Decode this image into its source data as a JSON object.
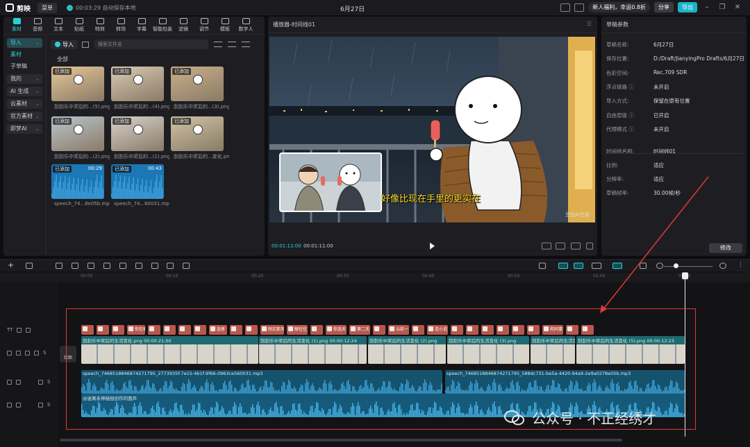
{
  "app": {
    "name": "剪映",
    "menu": "菜单",
    "autosave": "00:03:29 自动保存本地",
    "project_title": "6月27日"
  },
  "topbar": {
    "promo": "新人福利，幸运0.8折",
    "share": "分享",
    "export": "导出"
  },
  "tools": [
    "素材",
    "音频",
    "文本",
    "贴纸",
    "特效",
    "转场",
    "字幕",
    "智能包装",
    "滤镜",
    "调节",
    "模板",
    "数字人"
  ],
  "sidebar": {
    "items": [
      {
        "label": "导入",
        "active": true
      },
      {
        "label": "素材",
        "sub": true
      },
      {
        "label": "子草稿",
        "plain": true
      },
      {
        "label": "我的"
      },
      {
        "label": "AI 生成"
      },
      {
        "label": "云素材"
      },
      {
        "label": "官方素材"
      },
      {
        "label": "即梦AI"
      }
    ]
  },
  "media": {
    "import_label": "导入",
    "search_placeholder": "搜索文件名",
    "all_label": "全部",
    "items": [
      {
        "badge": "已添加",
        "name": "刮刮乐中奖后的...(5).png",
        "dur": ""
      },
      {
        "badge": "已添加",
        "name": "刮刮乐中奖后的...(4).png",
        "dur": ""
      },
      {
        "badge": "已添加",
        "name": "刮刮乐中奖后的...(3).png",
        "dur": ""
      },
      {
        "badge": "已添加",
        "name": "刮刮乐中奖后的...(2).png",
        "dur": ""
      },
      {
        "badge": "已添加",
        "name": "刮刮乐中奖后的...(1).png",
        "dur": ""
      },
      {
        "badge": "已添加",
        "name": "刮刮乐中奖后的...变化.png",
        "dur": ""
      },
      {
        "badge": "已添加",
        "name": "speech_74...8e05b.mp3",
        "dur": "00:29"
      },
      {
        "badge": "已添加",
        "name": "speech_74...60031.mp3",
        "dur": "00:43"
      }
    ]
  },
  "player": {
    "title": "播放器-时间线01",
    "subtitle": "好像比现在手里的更实在",
    "watermark": "豆包AI生成",
    "time_current": "00:01:11:00",
    "time_total": "00:01:11:00"
  },
  "props": {
    "title": "草稿参数",
    "rows": [
      {
        "label": "草稿名称:",
        "value": "6月27日"
      },
      {
        "label": "保存位置:",
        "value": "D:/Draft/JianyingPro Drafts/6月27日"
      },
      {
        "label": "色彩空间:",
        "value": "Rec.709 SDR"
      },
      {
        "label": "浮点链路 ⓘ",
        "value": "未开启"
      },
      {
        "label": "导入方式:",
        "value": "保留在原有位置"
      },
      {
        "label": "自由层级 ⓘ",
        "value": "已开启"
      },
      {
        "label": "代理模式 ⓘ",
        "value": "未开启"
      }
    ],
    "rows2": [
      {
        "label": "时间线名称:",
        "value": "时间线01"
      },
      {
        "label": "比例:",
        "value": "适应"
      },
      {
        "label": "分辨率:",
        "value": "适应"
      },
      {
        "label": "草稿帧率:",
        "value": "30.00帧/秒"
      }
    ],
    "modify": "修改"
  },
  "timeline": {
    "ticks": [
      "00:00",
      "00:10",
      "00:20",
      "00:30",
      "00:40",
      "00:50",
      "01:00",
      "01:10"
    ],
    "cover": "封面",
    "subtitle_clips": [
      "",
      "",
      "",
      "你在嘴",
      "",
      "",
      "",
      "",
      "选者",
      "",
      "",
      "刚买那天",
      "眼往往",
      "",
      "你选天",
      "第二天",
      "",
      "以前一",
      "",
      "连小说",
      "",
      "",
      "",
      "",
      "",
      "",
      "和同事",
      "",
      ""
    ],
    "video_clips": [
      {
        "label": "刮刮乐中奖后的生活变化.png  00:00:21:00"
      },
      {
        "label": "刮刮乐中奖后的生活变化 (1).png  00:00:12:24"
      },
      {
        "label": "刮刮乐中奖后的生活变化 (2).png"
      },
      {
        "label": "刮刮乐中奖后的生活变化 (3).png"
      },
      {
        "label": "刮刮乐中奖后的生活变化 (4).png"
      },
      {
        "label": "刮刮乐中奖后的生活变化 (5).png  00:00:12:23"
      }
    ],
    "audio1": [
      {
        "label": "speech_7468518846874271795_2773935f-7e15-4b1f-9f66-0963ce560031.mp3"
      },
      {
        "label": "speech_7468518846874271795_588dc731-be5a-4420-94a9-2e9a0278e05b.mp3"
      }
    ],
    "audio2": {
      "label": "@迷离永神秘园创作的面声"
    }
  },
  "watermark_footer": "公众号 · 不正经绣才",
  "colors": {
    "accent": "#2bd0d6",
    "subtitle_clip": "#b9574c",
    "video_clip": "#1d6a71",
    "audio_clip": "#14526e",
    "highlight_box": "#e03a3a"
  }
}
